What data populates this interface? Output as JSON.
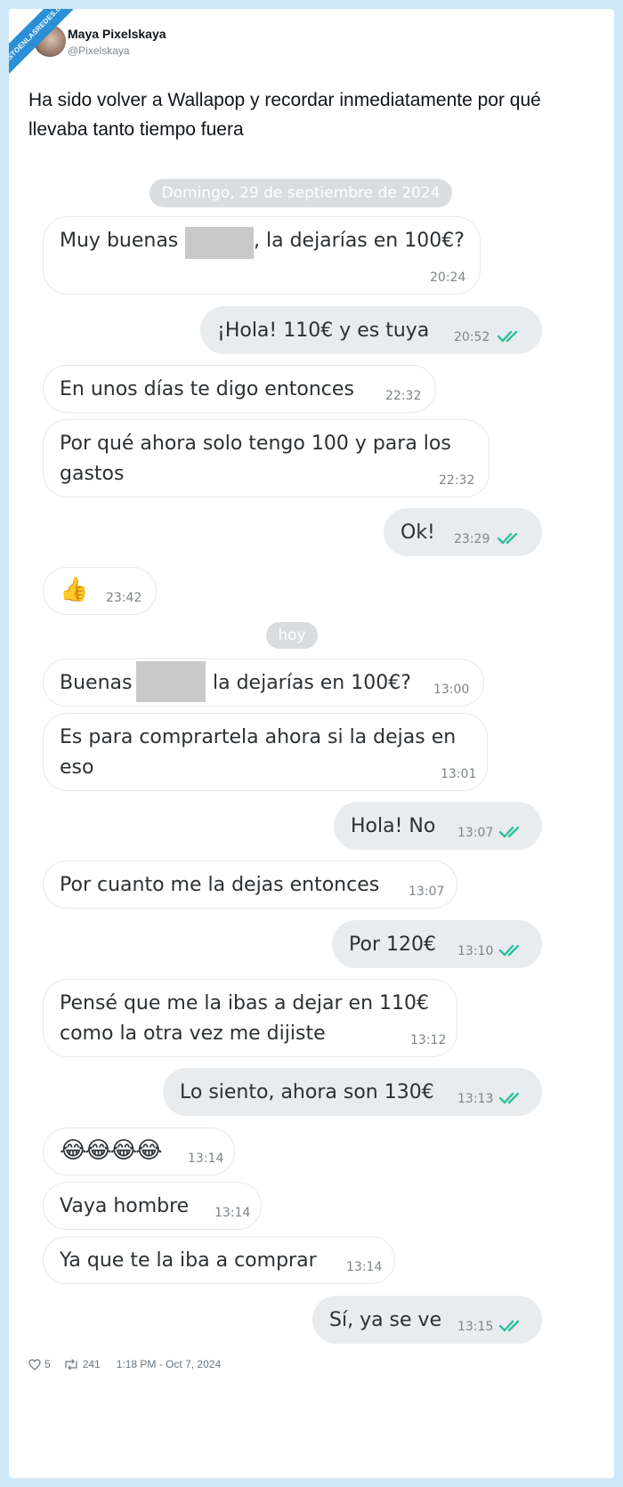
{
  "watermark": "VISTOENLASREDES.com",
  "tweet": {
    "author_name": "Maya Pixelskaya",
    "author_handle": "@Pixelskaya",
    "text": "Ha sido volver a Wallapop y recordar inmediatamente por qué llevaba tanto tiempo fuera",
    "likes": "5",
    "retweets": "241",
    "timestamp": "1:18 PM - Oct 7, 2024"
  },
  "chat": {
    "date_separator_1": "Domingo, 29 de septiembre de 2024",
    "date_separator_2": "hoy",
    "messages": [
      {
        "dir": "in",
        "lines": [
          "Muy buenas",
          ", la dejarías en 100€?"
        ],
        "time": "20:24"
      },
      {
        "dir": "out",
        "lines": [
          "¡Hola! 110€ y es tuya"
        ],
        "time": "20:52"
      },
      {
        "dir": "in",
        "lines": [
          "En unos días te digo entonces"
        ],
        "time": "22:32"
      },
      {
        "dir": "in",
        "lines": [
          "Por qué ahora solo tengo 100 y para los",
          "gastos"
        ],
        "time": "22:32"
      },
      {
        "dir": "out",
        "lines": [
          "Ok!"
        ],
        "time": "23:29"
      },
      {
        "dir": "in",
        "lines": [
          "👍"
        ],
        "time": "23:42"
      },
      {
        "dir": "in",
        "lines": [
          "Buenas",
          "la dejarías en 100€?"
        ],
        "time": "13:00"
      },
      {
        "dir": "in",
        "lines": [
          "Es para comprartela ahora si la dejas en",
          "eso"
        ],
        "time": "13:01"
      },
      {
        "dir": "out",
        "lines": [
          "Hola! No"
        ],
        "time": "13:07"
      },
      {
        "dir": "in",
        "lines": [
          "Por cuanto me la dejas entonces"
        ],
        "time": "13:07"
      },
      {
        "dir": "out",
        "lines": [
          "Por 120€"
        ],
        "time": "13:10"
      },
      {
        "dir": "in",
        "lines": [
          "Pensé que me la ibas a dejar en 110€",
          "como la otra vez me dijiste"
        ],
        "time": "13:12"
      },
      {
        "dir": "out",
        "lines": [
          "Lo siento, ahora son 130€"
        ],
        "time": "13:13"
      },
      {
        "dir": "in",
        "lines": [
          "😂😂😂😂"
        ],
        "time": "13:14"
      },
      {
        "dir": "in",
        "lines": [
          "Vaya hombre"
        ],
        "time": "13:14"
      },
      {
        "dir": "in",
        "lines": [
          "Ya que te la iba a comprar"
        ],
        "time": "13:14"
      },
      {
        "dir": "out",
        "lines": [
          "Sí, ya se ve"
        ],
        "time": "13:15"
      }
    ]
  },
  "colors": {
    "outer_bg": "#cfe8f8",
    "read_check": "#2bbf9f",
    "bubble_out": "#e9ecee",
    "bubble_in_border": "#e6e8ea"
  }
}
